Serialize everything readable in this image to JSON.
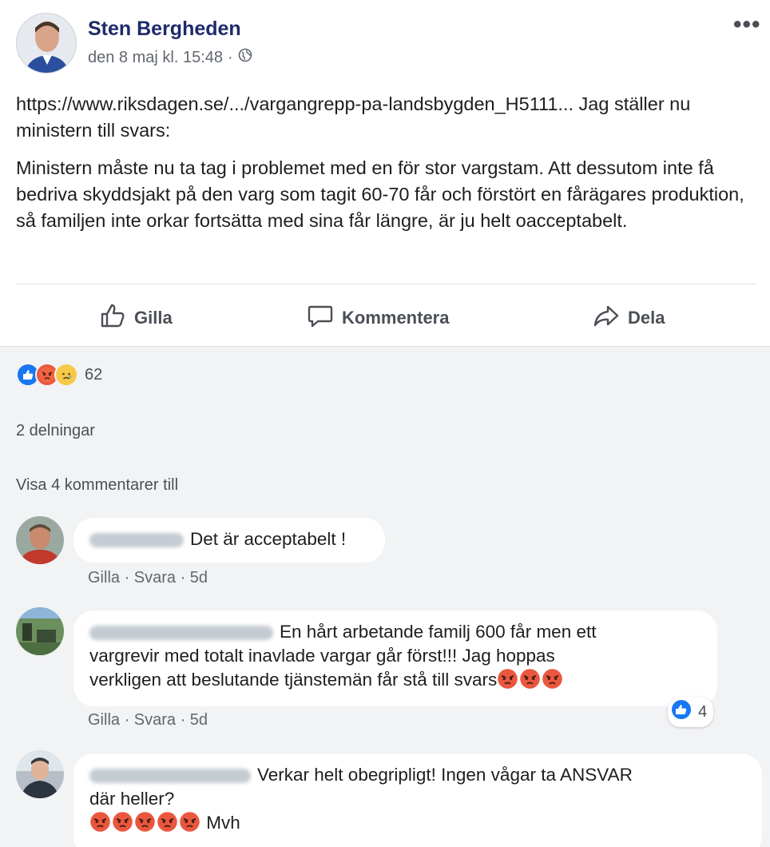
{
  "post": {
    "author": "Sten Bergheden",
    "timestamp": "den 8 maj kl. 15:48",
    "meta_separator": "·",
    "more_menu": "•••",
    "link_line": "https://www.riksdagen.se/.../vargangrepp-pa-landsbygden_H5111... Jag ställer nu ministern till svars:",
    "body": "Ministern måste nu ta tag i problemet med en för stor vargstam. Att dessutom inte få bedriva skyddsjakt på den varg som tagit 60-70 får och förstört en fårägares produktion, så familjen inte orkar fortsätta med sina får längre, är ju helt oacceptabelt."
  },
  "actions": {
    "like": "Gilla",
    "comment": "Kommentera",
    "share": "Dela"
  },
  "stats": {
    "reaction_count": "62",
    "shares": "2 delningar",
    "view_more_comments": "Visa 4 kommentarer till"
  },
  "comments": [
    {
      "text": "Det är acceptabelt !",
      "actions": "Gilla · Svara · 5d"
    },
    {
      "text_line1": "En hårt arbetande familj 600 får men ett",
      "text_line2": "vargrevir med totalt inavlade vargar går först!!! Jag hoppas",
      "text_line3": "verkligen att beslutande tjänstemän får stå till svars",
      "actions": "Gilla · Svara · 5d",
      "like_count": "4"
    },
    {
      "text_line1": "Verkar helt obegripligt! Ingen vågar ta ANSVAR",
      "text_line2": "där heller?",
      "signoff": "Mvh"
    }
  ],
  "colors": {
    "author": "#1f2a6b",
    "like_blue": "#1877f2",
    "angry_red": "#e9573f",
    "background_gray": "#f2f3f5"
  },
  "icons": [
    "thumbs-up-icon",
    "comment-bubble-icon",
    "share-arrow-icon",
    "globe-icon",
    "angry-face-icon",
    "sad-face-icon"
  ]
}
